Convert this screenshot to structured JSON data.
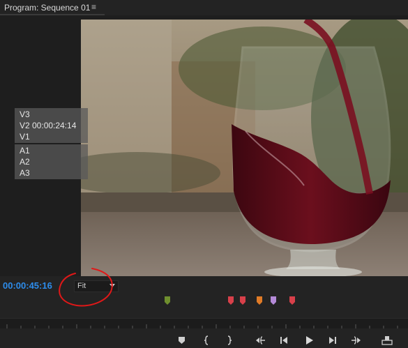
{
  "panel": {
    "title": "Program: Sequence 01",
    "menu_icon": "hamburger-menu-icon",
    "menu_glyph": "≡"
  },
  "overlay": {
    "video_tracks": [
      "V3",
      "V2 00:00:24:14",
      "V1"
    ],
    "audio_tracks": [
      "A1",
      "A2",
      "A3"
    ]
  },
  "controls": {
    "timecode": "00:00:45:16",
    "zoom_select": {
      "value": "Fit"
    },
    "markers": [
      {
        "color": "#6f8f2e"
      },
      {
        "color": "#d8404a"
      },
      {
        "color": "#d8404a"
      },
      {
        "color": "#e07b27"
      },
      {
        "color": "#b48ad8"
      },
      {
        "color": "#d8404a"
      }
    ],
    "buttons": [
      "add-marker-icon",
      "mark-in-icon",
      "mark-out-icon",
      "go-to-in-icon",
      "step-back-icon",
      "play-icon",
      "step-forward-icon",
      "go-to-out-icon",
      "lift-icon"
    ]
  },
  "colors": {
    "accent_timecode": "#2d8ceb",
    "annotation": "#e01818",
    "panel_bg": "#232323"
  }
}
